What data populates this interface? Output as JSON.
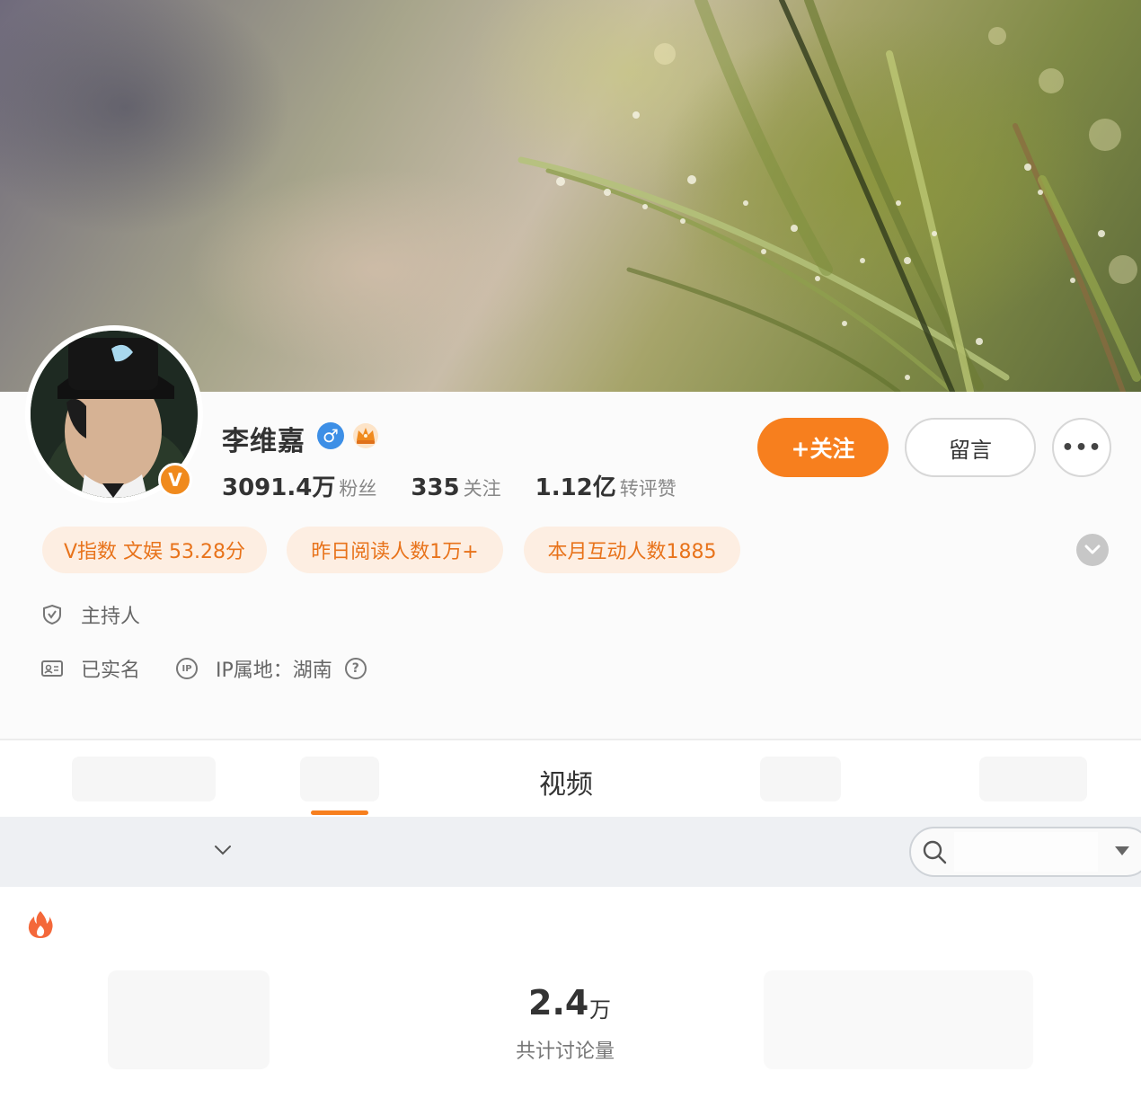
{
  "profile": {
    "name": "李维嘉",
    "stats": [
      {
        "value": "3091.4万",
        "label": "粉丝"
      },
      {
        "value": "335",
        "label": "关注"
      },
      {
        "value": "1.12亿",
        "label": "转评赞"
      }
    ],
    "verified_badge": "V",
    "gender_symbol": "♂"
  },
  "actions": {
    "follow_label": "+关注",
    "message_label": "留言",
    "more_label": "•••"
  },
  "tags": [
    {
      "text": "V指数 文娱 53.28分"
    },
    {
      "text": "昨日阅读人数1万+"
    },
    {
      "text": "本月互动人数1885"
    }
  ],
  "info": {
    "occupation": "主持人",
    "realname": "已实名",
    "ip_location": "IP属地：湖南",
    "ip_icon_text": "IP",
    "help_icon_text": "?"
  },
  "tabs": {
    "active_label": "视频"
  },
  "search": {
    "value": "",
    "placeholder": ""
  },
  "discussion": {
    "count": "2.4",
    "unit": "万",
    "label": "共计讨论量"
  },
  "colors": {
    "accent": "#f77f1e",
    "tag_bg": "#fdeee2",
    "tag_text": "#e8731b",
    "verify_blue": "#3d8fe6"
  },
  "icons": [
    "gender-male-icon",
    "crown-icon",
    "shield-check-icon",
    "id-card-icon",
    "ip-icon",
    "help-icon",
    "chevron-down-icon",
    "search-icon",
    "caret-down-icon",
    "fire-icon"
  ]
}
